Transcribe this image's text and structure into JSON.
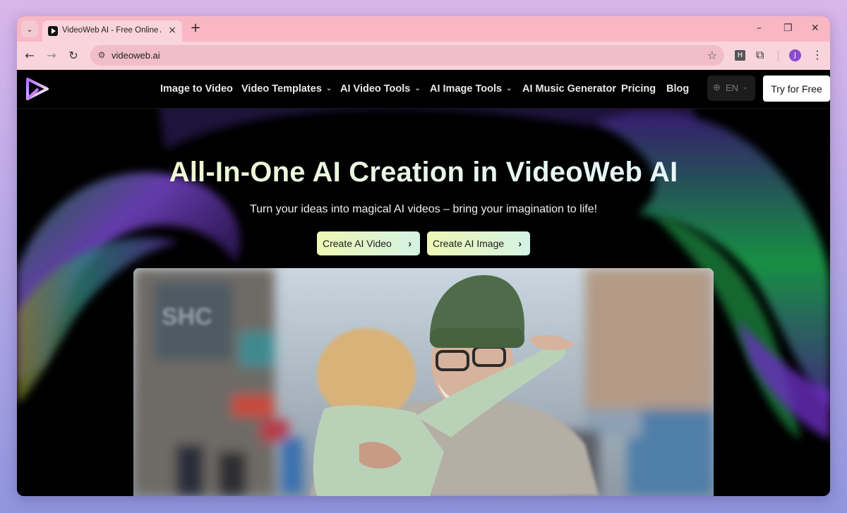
{
  "browser": {
    "tab_title": "VideoWeb AI - Free Online AI V",
    "tab_close": "×",
    "new_tab": "+",
    "url": "videoweb.ai",
    "ext_h": "H",
    "avatar_letter": "J",
    "win_minimize": "–",
    "win_restore": "❐",
    "win_close": "✕"
  },
  "site": {
    "nav": {
      "items": [
        {
          "label": "Image to Video",
          "dropdown": false
        },
        {
          "label": "Video Templates",
          "dropdown": true
        },
        {
          "label": "AI Video Tools",
          "dropdown": true
        },
        {
          "label": "AI Image Tools",
          "dropdown": true
        },
        {
          "label": "AI Music Generator",
          "dropdown": false
        },
        {
          "label": "Pricing",
          "dropdown": false
        },
        {
          "label": "Blog",
          "dropdown": false
        }
      ],
      "language": "EN",
      "cta": "Try for Free"
    },
    "hero": {
      "title": "All-In-One AI Creation in VideoWeb AI",
      "subtitle": "Turn your ideas into magical AI videos – bring your imagination to life!",
      "buttons": [
        {
          "label": "Create AI Video"
        },
        {
          "label": "Create AI Image"
        }
      ],
      "sign_text": "SHC"
    }
  },
  "colors": {
    "tab_strip": "#f9b7c4",
    "toolbar": "#f9d4dc",
    "page_bg": "#000000",
    "cta_gradient_start": "#eef7b4",
    "cta_gradient_end": "#d4f3e4"
  }
}
